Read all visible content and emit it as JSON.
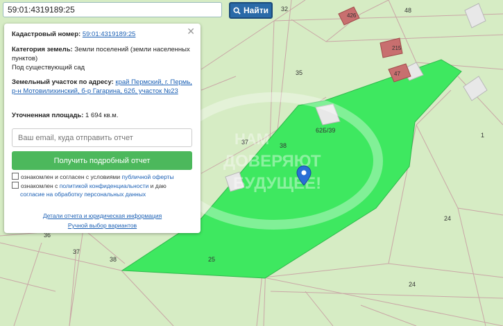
{
  "search": {
    "value": "59:01:4319189:25",
    "button_label": "Найти"
  },
  "popup": {
    "cadastral_label": "Кадастровый номер:",
    "cadastral_value": "59:01:4319189:25",
    "category_label": "Категория земель:",
    "category_value": "Земли поселений (земли населенных пунктов)",
    "usage_value": "Под существующий сад",
    "address_label": "Земельный участок по адресу:",
    "address_value": "край Пермский, г. Пермь, р-н Мотовилихинский, б-р Гагарина, 62б, участок №23",
    "area_label": "Уточненная площадь:",
    "area_value": "1 694 кв.м.",
    "email_placeholder": "Ваш email, куда отправить отчет",
    "report_button": "Получить подробный отчет",
    "consent1_prefix": "ознакомлен и согласен с условиями",
    "consent1_link": "публичной оферты",
    "consent2_prefix": "ознакомлен с",
    "consent2_link1": "политикой конфиденциальности",
    "consent2_mid": "и даю",
    "consent2_link2": "согласие на обработку персональных данных",
    "details_link": "Детали отчета и юридическая информация",
    "manual_link": "Ручной выбор вариантов"
  },
  "map": {
    "labels": [
      "32",
      "48",
      "426",
      "215",
      "47",
      "35",
      "62Б/39",
      "37",
      "38",
      "1",
      "24",
      "36",
      "37",
      "38",
      "25",
      "24"
    ],
    "watermark": "НАМ ДОВЕРЯЮТ БУДУЩЕЕ!",
    "colors": {
      "background": "#d6ecc4",
      "parcel": "#3ee860",
      "lines": "#c9a6a6",
      "building": "#c86f6f"
    }
  }
}
